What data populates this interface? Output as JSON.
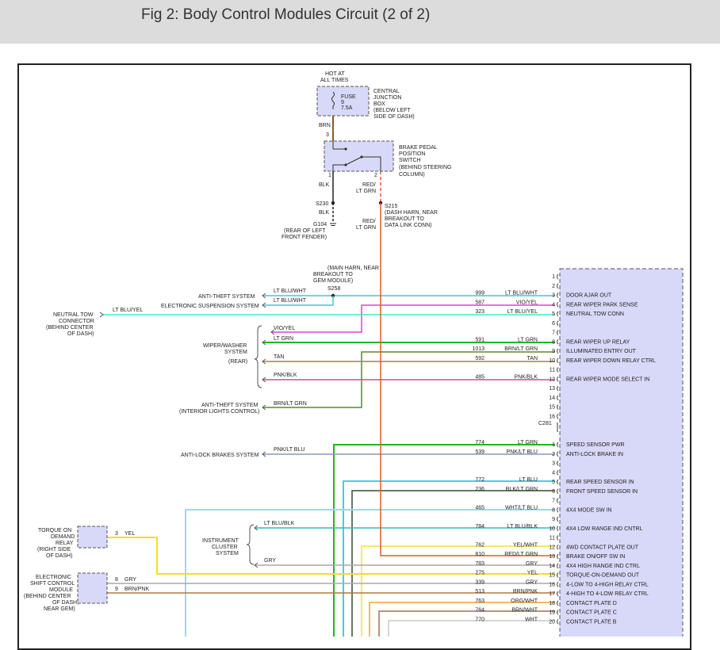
{
  "header": {
    "title": "Fig 2: Body Control Modules Circuit (2 of 2)"
  },
  "colors": {
    "lt_blu_wht": "#3ec8d8",
    "vio_yel": "#e040d0",
    "lt_blu_yel": "#40e8c8",
    "lt_grn": "#22b422",
    "brn_lt_grn": "#5a8a20",
    "tan": "#9a8a3a",
    "pnk_blk": "#d84a8a",
    "pnk_lt_blu": "#8898b8",
    "lt_blu": "#40d0e8",
    "blk_lt_grn": "#305030",
    "wht_lt_blu": "#a0d8e0",
    "lt_blu_blk": "#30b8c8",
    "yel_wht": "#f0e040",
    "red_lt_grn": "#e05a30",
    "gry": "#a8a8a8",
    "yel": "#f0e020",
    "brn_pnk": "#b07840",
    "org_wht": "#f0a040",
    "brn_wht": "#a07050",
    "wht": "#c8c8c8",
    "brn": "#8b5a2b",
    "module_fill": "#d8d8f8",
    "module_border": "#555555"
  },
  "top": {
    "hot_at_all_times": [
      "HOT AT",
      "ALL TIMES"
    ],
    "fuse_label": "FUSE",
    "fuse_num": "9",
    "fuse_amp": "7.5A",
    "central_junction_box": [
      "CENTRAL",
      "JUNCTION",
      "BOX",
      "(BELOW LEFT",
      "SIDE OF DASH)"
    ],
    "wire_brn": "BRN",
    "pin_3": "3",
    "brake_switch": [
      "BRAKE PEDAL",
      "POSITION",
      "SWITCH",
      "(BEHIND STEERING",
      "COLUMN)"
    ],
    "pin_1": "1",
    "pin_2": "2",
    "wire_blk": "BLK",
    "wire_red_lt_grn_1": [
      "RED/",
      "LT GRN"
    ],
    "s230": "S230",
    "wire_blk_2": "BLK",
    "g104": [
      "G104",
      "(REAR OF LEFT",
      "FRONT FENDER)"
    ],
    "s215": [
      "S215",
      "(DASH HARN, NEAR",
      "BREAKOUT TO",
      "DATA LINK CONN)"
    ],
    "wire_red_lt_grn_2": [
      "RED/",
      "LT GRN"
    ]
  },
  "middle": {
    "main_harn": [
      "(MAIN HARN, NEAR",
      "BREAKOUT TO",
      "GEM MODULE)",
      "S258"
    ],
    "anti_theft": "ANTI-THEFT SYSTEM",
    "electronic_suspension": "ELECTRONIC SUSPENSION SYSTEM",
    "neutral_tow": [
      "NEUTRAL TOW",
      "CONNECTOR",
      "(BEHIND CENTER",
      "OF DASH)"
    ],
    "wiper_washer": [
      "WIPER/WASHER",
      "SYSTEM",
      "(REAR)"
    ],
    "anti_theft_interior": [
      "ANTI-THEFT SYSTEM",
      "(INTERIOR LIGHTS CONTROL)"
    ],
    "anti_lock": "ANTI-LOCK BRAKES SYSTEM",
    "instrument_cluster": [
      "INSTRUMENT",
      "CLUSTER",
      "SYSTEM"
    ],
    "torque_on_demand": [
      "TORQUE ON",
      "DEMAND",
      "RELAY",
      "(RIGHT SIDE",
      "OF DASH)"
    ],
    "electronic_shift": [
      "ELECTRONIC",
      "SHIFT CONTROL",
      "MODULE",
      "(BEHIND CENTER",
      "OF DASH,",
      "NEAR GEM)"
    ],
    "left_wire_labels": {
      "lt_blu_wht_a": "LT BLU/WHT",
      "lt_blu_wht_b": "LT BLU/WHT",
      "lt_blu_yel": "LT BLU/YEL",
      "vio_yel": "VIO/YEL",
      "lt_grn": "LT GRN",
      "tan": "TAN",
      "pnk_blk": "PNK/BLK",
      "brn_lt_grn": "BRN/LT GRN",
      "pnk_lt_blu": "PNK/LT BLU",
      "lt_blu_blk": "LT BLU/BLK",
      "gry": "GRY",
      "yel": "YEL",
      "gry_shift": "GRY",
      "brn_pnk_shift": "BRN/PNK",
      "pin_3_tod": "3",
      "pin_8_shift": "8",
      "pin_9_shift": "9"
    }
  },
  "connector_c281": "C281",
  "connector1_rows": [
    {
      "pin": "1",
      "circuit": "",
      "wire": "",
      "func": ""
    },
    {
      "pin": "2",
      "circuit": "",
      "wire": "",
      "func": ""
    },
    {
      "pin": "3",
      "circuit": "999",
      "wire": "LT BLU/WHT",
      "func": "DOOR AJAR OUT"
    },
    {
      "pin": "4",
      "circuit": "587",
      "wire": "VIO/YEL",
      "func": "REAR WIPER PARK SENSE"
    },
    {
      "pin": "5",
      "circuit": "323",
      "wire": "LT BLU/YEL",
      "func": "NEUTRAL TOW CONN"
    },
    {
      "pin": "6",
      "circuit": "",
      "wire": "",
      "func": ""
    },
    {
      "pin": "7",
      "circuit": "",
      "wire": "",
      "func": ""
    },
    {
      "pin": "8",
      "circuit": "591",
      "wire": "LT GRN",
      "func": "REAR WIPER UP RELAY"
    },
    {
      "pin": "9",
      "circuit": "1013",
      "wire": "BRN/LT GRN",
      "func": "ILLUMINATED ENTRY OUT"
    },
    {
      "pin": "10",
      "circuit": "592",
      "wire": "TAN",
      "func": "REAR WIPER DOWN RELAY CTRL"
    },
    {
      "pin": "11",
      "circuit": "",
      "wire": "",
      "func": ""
    },
    {
      "pin": "12",
      "circuit": "485",
      "wire": "PNK/BLK",
      "func": "REAR WIPER MODE SELECT IN"
    },
    {
      "pin": "13",
      "circuit": "",
      "wire": "",
      "func": ""
    },
    {
      "pin": "14",
      "circuit": "",
      "wire": "",
      "func": ""
    },
    {
      "pin": "15",
      "circuit": "",
      "wire": "",
      "func": ""
    },
    {
      "pin": "16",
      "circuit": "",
      "wire": "",
      "func": ""
    }
  ],
  "connector2_rows": [
    {
      "pin": "1",
      "circuit": "774",
      "wire": "LT GRN",
      "func": "SPEED SENSOR PWR"
    },
    {
      "pin": "2",
      "circuit": "539",
      "wire": "PNK/LT BLU",
      "func": "ANTI-LOCK BRAKE IN"
    },
    {
      "pin": "3",
      "circuit": "",
      "wire": "",
      "func": ""
    },
    {
      "pin": "4",
      "circuit": "",
      "wire": "",
      "func": ""
    },
    {
      "pin": "5",
      "circuit": "772",
      "wire": "LT BLU",
      "func": "REAR SPEED SENSOR IN"
    },
    {
      "pin": "6",
      "circuit": "236",
      "wire": "BLK/LT GRN",
      "func": "FRONT SPEED SENSOR IN"
    },
    {
      "pin": "7",
      "circuit": "",
      "wire": "",
      "func": ""
    },
    {
      "pin": "8",
      "circuit": "465",
      "wire": "WHT/LT BLU",
      "func": "4X4 MODE SW IN"
    },
    {
      "pin": "9",
      "circuit": "",
      "wire": "",
      "func": ""
    },
    {
      "pin": "10",
      "circuit": "784",
      "wire": "LT BLU/BLK",
      "func": "4X4 LOW RANGE IND CNTRL"
    },
    {
      "pin": "11",
      "circuit": "",
      "wire": "",
      "func": ""
    },
    {
      "pin": "12",
      "circuit": "762",
      "wire": "YEL/WHT",
      "func": "4WD CONTACT PLATE OUT"
    },
    {
      "pin": "13",
      "circuit": "810",
      "wire": "RED/LT GRN",
      "func": "BRAKE ON/OFF SW IN"
    },
    {
      "pin": "14",
      "circuit": "783",
      "wire": "GRY",
      "func": "4X4 HIGH RANGE IND CTRL"
    },
    {
      "pin": "15",
      "circuit": "275",
      "wire": "YEL",
      "func": "TORQUE-ON-DEMAND OUT"
    },
    {
      "pin": "16",
      "circuit": "339",
      "wire": "GRY",
      "func": "4-LOW TO 4-HIGH RELAY CTRL"
    },
    {
      "pin": "17",
      "circuit": "513",
      "wire": "BRN/PNK",
      "func": "4-HIGH TO 4-LOW RELAY CTRL"
    },
    {
      "pin": "18",
      "circuit": "763",
      "wire": "ORG/WHT",
      "func": "CONTACT PLATE D"
    },
    {
      "pin": "19",
      "circuit": "764",
      "wire": "BRN/WHT",
      "func": "CONTACT PLATE C"
    },
    {
      "pin": "20",
      "circuit": "770",
      "wire": "WHT",
      "func": "CONTACT PLATE B"
    }
  ]
}
